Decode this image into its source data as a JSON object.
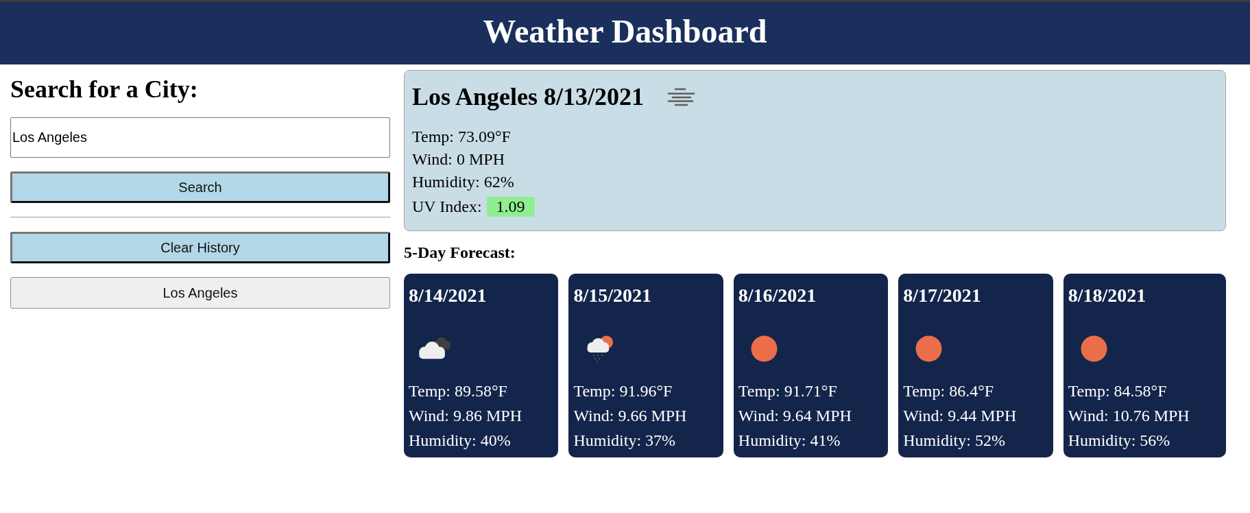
{
  "header": {
    "title": "Weather Dashboard"
  },
  "search": {
    "heading": "Search for a City:",
    "input": {
      "value": "Los Angeles"
    },
    "search_button": "Search",
    "clear_button": "Clear History",
    "history": [
      {
        "label": "Los Angeles"
      }
    ]
  },
  "current": {
    "title": "Los Angeles 8/13/2021",
    "details": [
      "Temp: 73.09°F",
      "Wind: 0 MPH",
      "Humidity: 62%"
    ],
    "uv": {
      "label": "UV Index:",
      "value": "1.09"
    }
  },
  "forecast": {
    "heading": "5-Day Forecast:",
    "days": [
      {
        "date": "8/14/2021",
        "kind": "clouds",
        "temp": "Temp: 89.58°F",
        "wind": "Wind: 9.86 MPH",
        "humidity": "Humidity: 40%"
      },
      {
        "date": "8/15/2021",
        "kind": "rain",
        "temp": "Temp: 91.96°F",
        "wind": "Wind: 9.66 MPH",
        "humidity": "Humidity: 37%"
      },
      {
        "date": "8/16/2021",
        "kind": "clear",
        "temp": "Temp: 91.71°F",
        "wind": "Wind: 9.64 MPH",
        "humidity": "Humidity: 41%"
      },
      {
        "date": "8/17/2021",
        "kind": "clear",
        "temp": "Temp: 86.4°F",
        "wind": "Wind: 9.44 MPH",
        "humidity": "Humidity: 52%"
      },
      {
        "date": "8/18/2021",
        "kind": "clear",
        "temp": "Temp: 84.58°F",
        "wind": "Wind: 10.76 MPH",
        "humidity": "Humidity: 56%"
      }
    ]
  }
}
